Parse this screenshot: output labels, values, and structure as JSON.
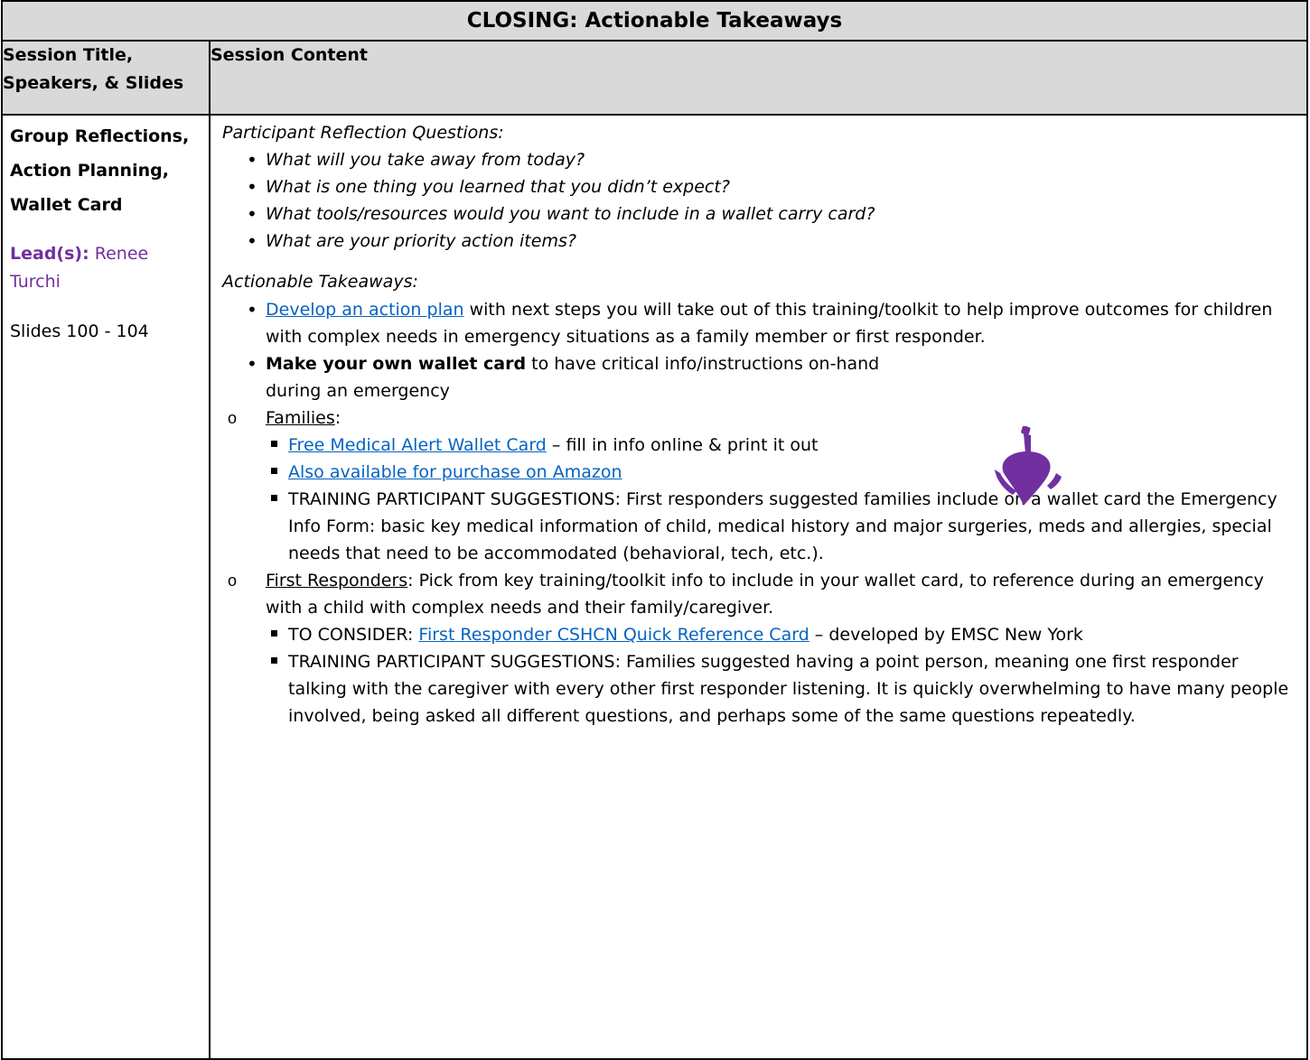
{
  "title": "CLOSING: Actionable Takeaways",
  "headers": {
    "col1": "Session Title, Speakers, & Slides",
    "col2": "Session Content"
  },
  "left": {
    "session_lines": [
      "Group Reflections,",
      "Action Planning,",
      "Wallet Card"
    ],
    "lead_label": "Lead(s):",
    "lead_name_1": "Renee",
    "lead_name_2": "Turchi",
    "slides": "Slides 100 - 104"
  },
  "right": {
    "reflection_heading": "Participant Reflection Questions:",
    "reflection_questions": [
      "What will you take away from today?",
      "What is one thing you learned that you didn’t expect?",
      "What tools/resources would you want to include in a wallet carry card?",
      "What are your priority action items?"
    ],
    "takeaways_heading": "Actionable Takeaways:",
    "takeaway1_link": "Develop an action plan",
    "takeaway1_text": " with next steps you will take out of this training/toolkit to help improve outcomes for children with complex needs in emergency situations as a family member or first responder.",
    "takeaway2_bold": "Make your own wallet card",
    "takeaway2_text_1": " to have critical info/instructions on-hand",
    "takeaway2_text_2": "during an emergency",
    "families_label": "Families",
    "families_colon": ":",
    "families_item1_link": "Free Medical Alert Wallet Card",
    "families_item1_text": " – fill in info online & print it out",
    "families_item2_link": "Also available for purchase on Amazon",
    "families_item3": "TRAINING PARTICIPANT SUGGESTIONS: First responders suggested families include on a wallet card the Emergency Info Form: basic key medical information of child, medical history and major surgeries, meds and allergies, special needs that need to be accommodated (behavioral, tech, etc.).",
    "fr_label": "First Responders",
    "fr_text": ":  Pick from key training/toolkit info to include in your wallet card, to reference during an emergency with a child with complex needs and their family/caregiver.",
    "fr_item1_prefix": "TO CONSIDER: ",
    "fr_item1_link": "First Responder CSHCN Quick Reference Card",
    "fr_item1_text": " – developed by EMSC New York",
    "fr_item2": "TRAINING PARTICIPANT SUGGESTIONS: Families suggested having a point person, meaning one first responder talking with the caregiver with every other first responder listening.  It is quickly overwhelming to have many people involved, being asked all different questions, and perhaps some of the same questions repeatedly."
  },
  "colors": {
    "header_bg": "#d9d9d9",
    "lead_purple": "#7030a0",
    "link_blue": "#0563c1",
    "icon_purple": "#7030a0"
  },
  "icons": [
    "spinning-top-icon"
  ]
}
